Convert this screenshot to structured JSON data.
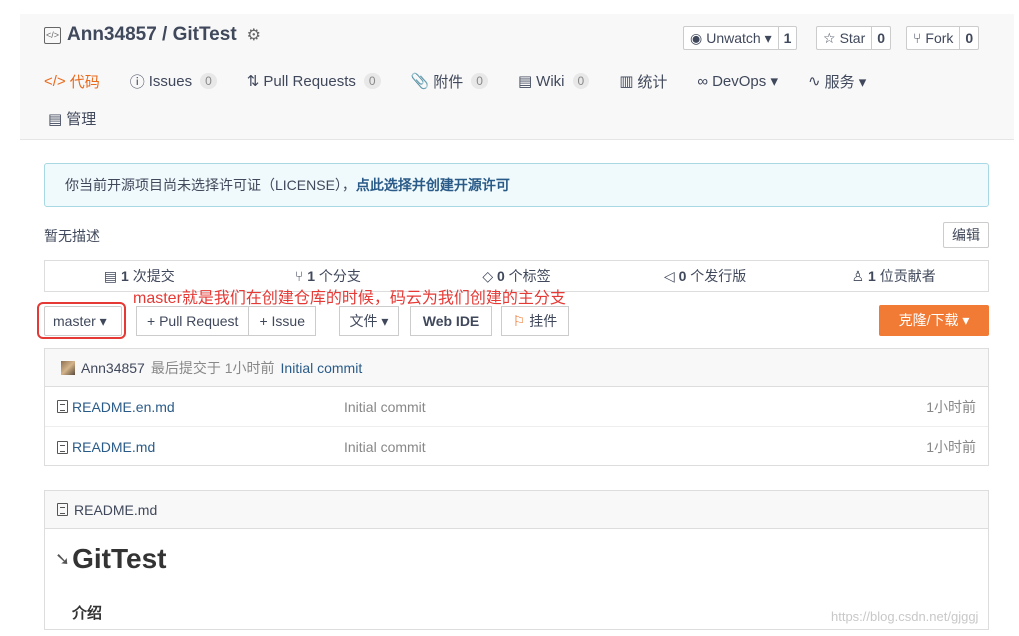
{
  "repo": {
    "owner_repo": "Ann34857 / GitTest",
    "code_icon": "code-icon",
    "badge_icon": "verified-badge-icon"
  },
  "actions": {
    "watch": {
      "label": "Unwatch ▾",
      "count": "1"
    },
    "star": {
      "label": "Star",
      "count": "0"
    },
    "fork": {
      "label": "Fork",
      "count": "0"
    }
  },
  "tabs": [
    {
      "label": "代码",
      "icon": "</>"
    },
    {
      "label": "Issues",
      "badge": "0",
      "icon": "ⓘ"
    },
    {
      "label": "Pull Requests",
      "badge": "0",
      "icon": "⇅"
    },
    {
      "label": "附件",
      "badge": "0",
      "icon": "📎"
    },
    {
      "label": "Wiki",
      "badge": "0",
      "icon": "▤"
    },
    {
      "label": "统计",
      "icon": "▥"
    },
    {
      "label": "DevOps ▾",
      "icon": "∞"
    },
    {
      "label": "服务 ▾",
      "icon": "∿"
    }
  ],
  "manage_label": "管理",
  "license": {
    "text": "你当前开源项目尚未选择许可证（LICENSE），",
    "link": "点此选择并创建开源许可"
  },
  "description": "暂无描述",
  "edit_label": "编辑",
  "stats": [
    {
      "num": "1",
      "label": "次提交"
    },
    {
      "num": "1",
      "label": "个分支"
    },
    {
      "num": "0",
      "label": "个标签"
    },
    {
      "num": "0",
      "label": "个发行版"
    },
    {
      "num": "1",
      "label": "位贡献者"
    }
  ],
  "annotation": "master就是我们在创建仓库的时候，码云为我们创建的主分支",
  "branch": "master ▾",
  "pull_request_label": "+ Pull Request",
  "issue_label": "+ Issue",
  "file_label": "文件 ▾",
  "webide_label": "Web IDE",
  "pin_label": "挂件",
  "clone_label": "克隆/下载 ▾",
  "commit": {
    "author": "Ann34857",
    "meta": "最后提交于 1小时前",
    "message": "Initial commit"
  },
  "files": [
    {
      "name": "README.en.md",
      "message": "Initial commit",
      "time": "1小时前"
    },
    {
      "name": "README.md",
      "message": "Initial commit",
      "time": "1小时前"
    }
  ],
  "readme": {
    "filename": "README.md",
    "title": "GitTest",
    "section": "介绍"
  },
  "watermark": "https://blog.csdn.net/gjggj"
}
